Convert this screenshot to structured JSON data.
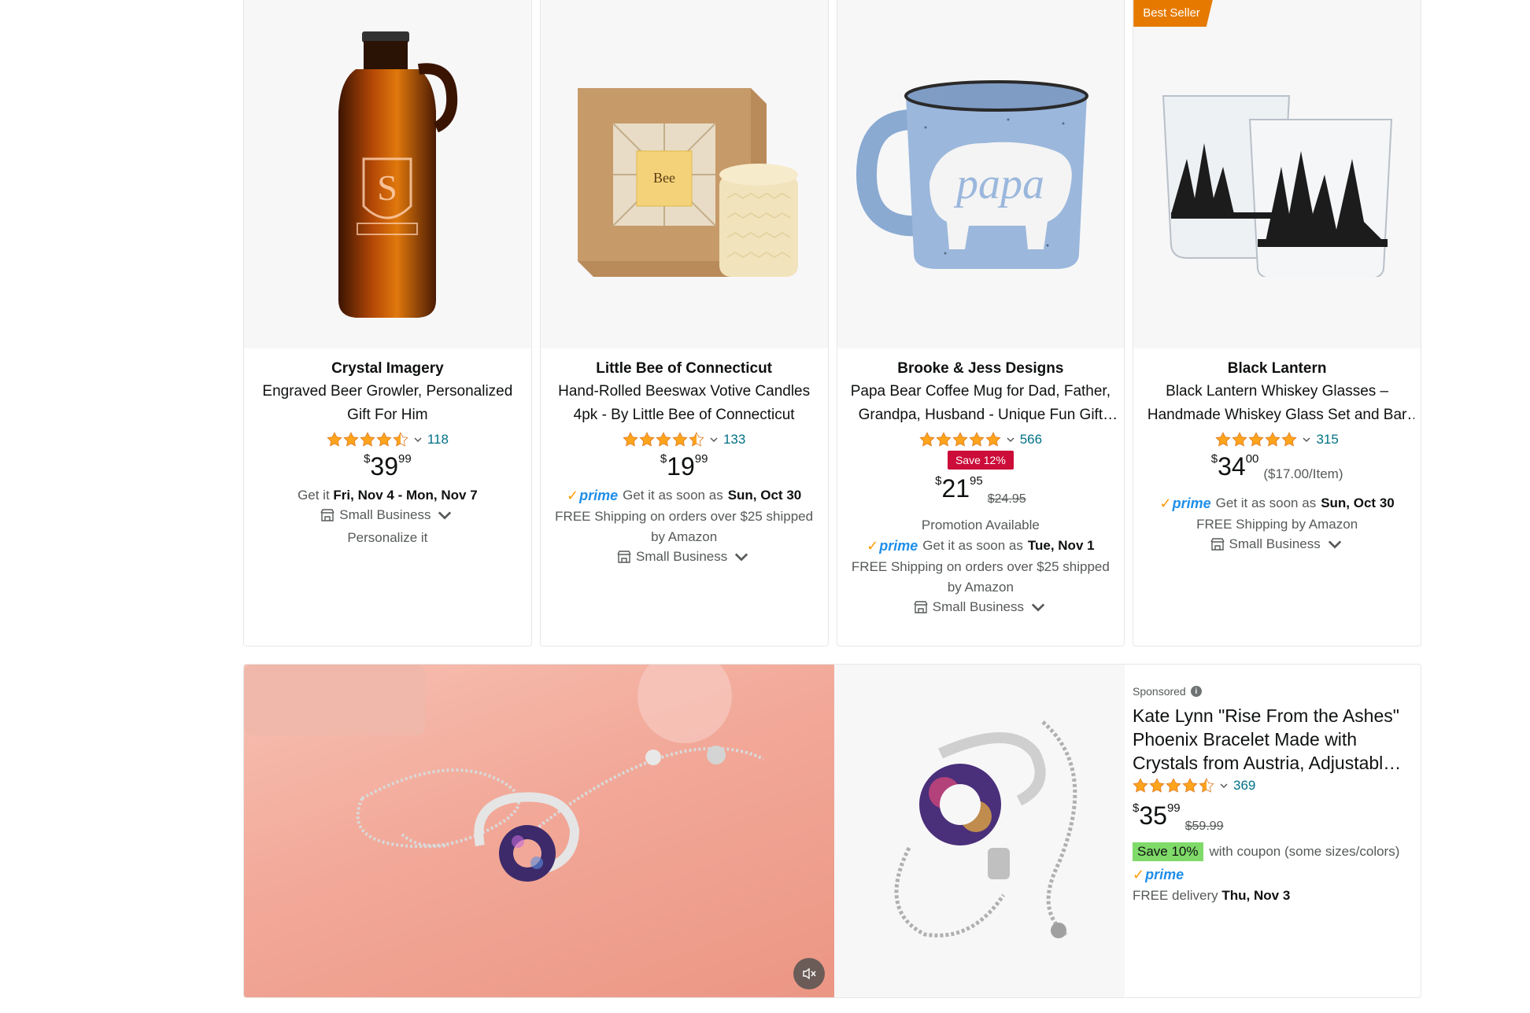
{
  "products": [
    {
      "brand": "Crystal Imagery",
      "title": "Engraved Beer Growler, Personalized Gift For Him",
      "rating_count": "118",
      "rating": 4.5,
      "price_symbol": "$",
      "price_whole": "39",
      "price_fraction": "99",
      "delivery_prefix": "Get it",
      "delivery_date": "Fri, Nov 4 - Mon, Nov 7",
      "small_business": "Small Business",
      "extra": "Personalize it",
      "badge": ""
    },
    {
      "brand": "Little Bee of Connecticut",
      "title": "Hand-Rolled Beeswax Votive Candles 4pk - By Little Bee of Connecticut",
      "rating_count": "133",
      "rating": 4.5,
      "price_symbol": "$",
      "price_whole": "19",
      "price_fraction": "99",
      "prime": "prime",
      "delivery_prefix": "Get it as soon as",
      "delivery_date": "Sun, Oct 30",
      "shipping": "FREE Shipping on orders over $25 shipped by Amazon",
      "small_business": "Small Business"
    },
    {
      "brand": "Brooke & Jess Designs",
      "title": "Papa Bear Coffee Mug for Dad, Father, Grandpa, Husband - Unique Fun Gift Idea",
      "rating_count": "566",
      "rating": 5,
      "save_badge": "Save 12%",
      "price_symbol": "$",
      "price_whole": "21",
      "price_fraction": "95",
      "was_price": "$24.95",
      "promotion": "Promotion Available",
      "prime": "prime",
      "delivery_prefix": "Get it as soon as",
      "delivery_date": "Tue, Nov 1",
      "shipping": "FREE Shipping on orders over $25 shipped by Amazon",
      "small_business": "Small Business"
    },
    {
      "brand": "Black Lantern",
      "title": "Black Lantern Whiskey Glasses – Handmade Whiskey Glass Set and Bar Accessories",
      "rating_count": "315",
      "rating": 5,
      "badge": "Best Seller",
      "price_symbol": "$",
      "price_whole": "34",
      "price_fraction": "00",
      "unit_price": "($17.00/Item)",
      "prime": "prime",
      "delivery_prefix": "Get it as soon as",
      "delivery_date": "Sun, Oct 30",
      "shipping": "FREE Shipping by Amazon",
      "small_business": "Small Business"
    }
  ],
  "sponsored": {
    "label": "Sponsored",
    "title": "Kate Lynn \"Rise From the Ashes\" Phoenix Bracelet Made with Crystals from Austria, Adjustable Bracelet",
    "rating_count": "369",
    "rating": 4.5,
    "price_symbol": "$",
    "price_whole": "35",
    "price_fraction": "99",
    "was_price": "$59.99",
    "coupon": "Save 10%",
    "coupon_text": "with coupon (some sizes/colors)",
    "prime": "prime",
    "delivery_prefix": "FREE delivery",
    "delivery_date": "Thu, Nov 3"
  },
  "colors": {
    "accent_star": "#ffa41c",
    "prime_blue": "#1f8ee8",
    "save_red": "#cc0c39",
    "coupon_green": "#7fda69",
    "best_seller": "#e67a00",
    "link_teal": "#007185"
  }
}
